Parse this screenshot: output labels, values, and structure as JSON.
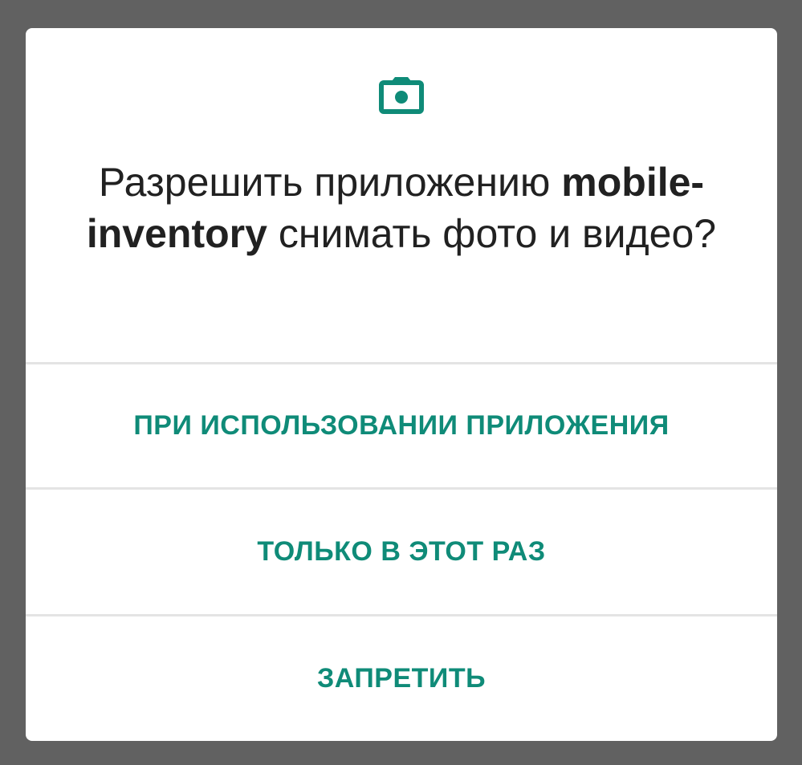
{
  "colors": {
    "scrim": "#616161",
    "dialog_background": "#ffffff",
    "accent": "#0f8b78",
    "title_text": "#212121",
    "divider": "#e4e4e4"
  },
  "dialog": {
    "icon": "camera-icon",
    "title_prefix": "Разрешить приложению",
    "app_name": "mobile-inventory",
    "title_suffix": "снимать фото и видео?"
  },
  "options": [
    {
      "label": "ПРИ ИСПОЛЬЗОВАНИИ ПРИЛОЖЕНИЯ"
    },
    {
      "label": "ТОЛЬКО В ЭТОТ РАЗ"
    },
    {
      "label": "ЗАПРЕТИТЬ"
    }
  ]
}
